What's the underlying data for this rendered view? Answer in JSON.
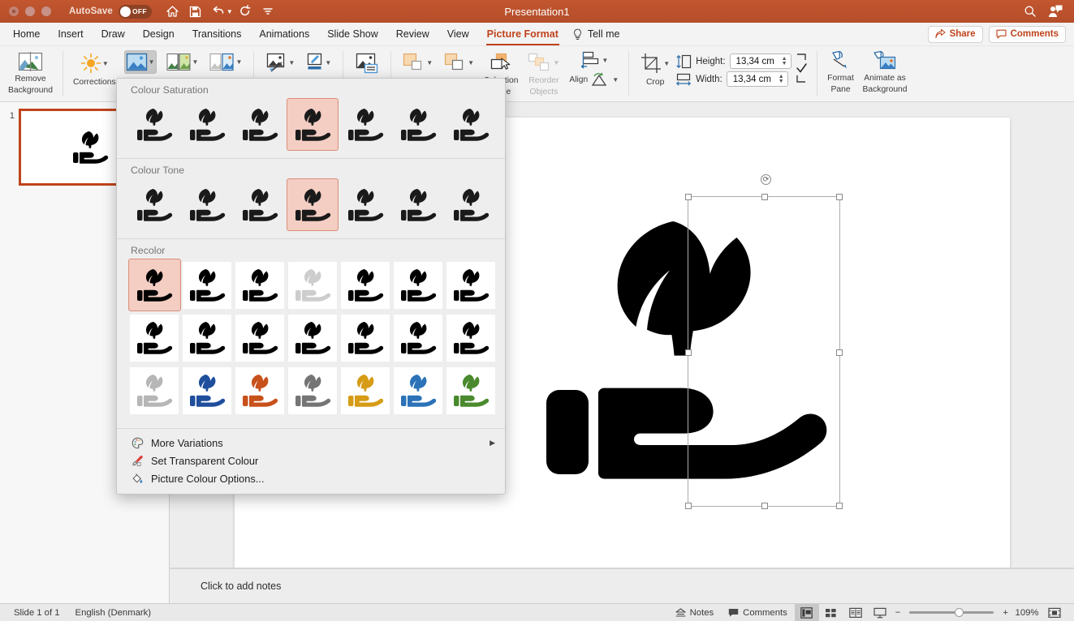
{
  "window": {
    "title": "Presentation1",
    "autosave_label": "AutoSave",
    "autosave_state": "OFF",
    "quick_access": [
      "home-icon",
      "save-icon",
      "undo-icon",
      "redo-icon",
      "customize-icon"
    ],
    "search_icon": "search-icon",
    "account_icon": "account-icon"
  },
  "tabs": [
    {
      "label": "Home",
      "active": false
    },
    {
      "label": "Insert",
      "active": false
    },
    {
      "label": "Draw",
      "active": false
    },
    {
      "label": "Design",
      "active": false
    },
    {
      "label": "Transitions",
      "active": false
    },
    {
      "label": "Animations",
      "active": false
    },
    {
      "label": "Slide Show",
      "active": false
    },
    {
      "label": "Review",
      "active": false
    },
    {
      "label": "View",
      "active": false
    },
    {
      "label": "Picture Format",
      "active": true
    }
  ],
  "tellme": {
    "label": "Tell me",
    "icon": "lightbulb-icon"
  },
  "tabbar_right": [
    {
      "label": "Share",
      "icon": "share-icon"
    },
    {
      "label": "Comments",
      "icon": "comment-icon"
    }
  ],
  "ribbon": {
    "remove_background": "Remove\nBackground",
    "remove_background_line1": "Remove",
    "remove_background_line2": "Background",
    "corrections": "Corrections",
    "colour_button": "colour-picture-icon",
    "artistic_effects": "artistic-effects-icon",
    "transparency": "transparency-icon",
    "picture_styles": "picture-styles-icon",
    "picture_border": "picture-border-icon",
    "picture_effects": "picture-effects-icon",
    "alt_text": "alt-text-icon",
    "bring_forward": "bring-forward-icon",
    "send_backward": "send-backward-icon",
    "selection_pane_line1": "Selection",
    "selection_pane_line2": "Pane",
    "reorder_objects_line1": "Reorder",
    "reorder_objects_line2": "Objects",
    "align": "Align",
    "rotate": "rotate-icon",
    "crop": "Crop",
    "height_label": "Height:",
    "height_value": "13,34 cm",
    "width_label": "Width:",
    "width_value": "13,34 cm",
    "format_pane_line1": "Format",
    "format_pane_line2": "Pane",
    "animate_bg_line1": "Animate as",
    "animate_bg_line2": "Background"
  },
  "colour_menu": {
    "sections": [
      {
        "title": "Colour Saturation",
        "items": [
          {
            "name": "saturation-0",
            "selected": false,
            "fill": "#1a1a1a",
            "white_tile": false
          },
          {
            "name": "saturation-33",
            "selected": false,
            "fill": "#1a1a1a",
            "white_tile": false
          },
          {
            "name": "saturation-66",
            "selected": false,
            "fill": "#1a1a1a",
            "white_tile": false
          },
          {
            "name": "saturation-100",
            "selected": true,
            "fill": "#1a1a1a",
            "white_tile": false
          },
          {
            "name": "saturation-200",
            "selected": false,
            "fill": "#1a1a1a",
            "white_tile": false
          },
          {
            "name": "saturation-300",
            "selected": false,
            "fill": "#1a1a1a",
            "white_tile": false
          },
          {
            "name": "saturation-400",
            "selected": false,
            "fill": "#1a1a1a",
            "white_tile": false
          }
        ]
      },
      {
        "title": "Colour Tone",
        "items": [
          {
            "name": "tone-4700k",
            "selected": false,
            "fill": "#1a1a1a",
            "white_tile": false
          },
          {
            "name": "tone-5300k",
            "selected": false,
            "fill": "#1a1a1a",
            "white_tile": false
          },
          {
            "name": "tone-5900k",
            "selected": false,
            "fill": "#1a1a1a",
            "white_tile": false
          },
          {
            "name": "tone-6500k",
            "selected": true,
            "fill": "#1a1a1a",
            "white_tile": false
          },
          {
            "name": "tone-7200k",
            "selected": false,
            "fill": "#1a1a1a",
            "white_tile": false
          },
          {
            "name": "tone-8800k",
            "selected": false,
            "fill": "#1a1a1a",
            "white_tile": false
          },
          {
            "name": "tone-11200k",
            "selected": false,
            "fill": "#1a1a1a",
            "white_tile": false
          }
        ]
      },
      {
        "title": "Recolor",
        "items": [
          {
            "name": "recolor-no-recolor",
            "selected": true,
            "fill": "#000000",
            "white_tile": false
          },
          {
            "name": "recolor-grayscale",
            "selected": false,
            "fill": "#000000",
            "white_tile": true
          },
          {
            "name": "recolor-sepia",
            "selected": false,
            "fill": "#000000",
            "white_tile": true
          },
          {
            "name": "recolor-washout",
            "selected": false,
            "fill": "#cdcdcd",
            "white_tile": true
          },
          {
            "name": "recolor-black-white",
            "selected": false,
            "fill": "#000000",
            "white_tile": true
          },
          {
            "name": "recolor-dark-variant-1",
            "selected": false,
            "fill": "#000000",
            "white_tile": true
          },
          {
            "name": "recolor-dark-variant-2",
            "selected": false,
            "fill": "#000000",
            "white_tile": true
          },
          {
            "name": "recolor-dark-variant-3",
            "selected": false,
            "fill": "#000000",
            "white_tile": true
          },
          {
            "name": "recolor-dark-variant-4",
            "selected": false,
            "fill": "#000000",
            "white_tile": true
          },
          {
            "name": "recolor-dark-variant-5",
            "selected": false,
            "fill": "#000000",
            "white_tile": true
          },
          {
            "name": "recolor-dark-variant-6",
            "selected": false,
            "fill": "#000000",
            "white_tile": true
          },
          {
            "name": "recolor-dark-variant-7",
            "selected": false,
            "fill": "#000000",
            "white_tile": true
          },
          {
            "name": "recolor-dark-variant-8",
            "selected": false,
            "fill": "#000000",
            "white_tile": true
          },
          {
            "name": "recolor-dark-variant-9",
            "selected": false,
            "fill": "#000000",
            "white_tile": true
          },
          {
            "name": "recolor-light-grey",
            "selected": false,
            "fill": "#b6b6b6",
            "white_tile": true
          },
          {
            "name": "recolor-dark-blue",
            "selected": false,
            "fill": "#1f4e9c",
            "white_tile": true
          },
          {
            "name": "recolor-orange",
            "selected": false,
            "fill": "#c8511b",
            "white_tile": true
          },
          {
            "name": "recolor-grey",
            "selected": false,
            "fill": "#757575",
            "white_tile": true
          },
          {
            "name": "recolor-gold",
            "selected": false,
            "fill": "#d69c16",
            "white_tile": true
          },
          {
            "name": "recolor-blue",
            "selected": false,
            "fill": "#2b72b8",
            "white_tile": true
          },
          {
            "name": "recolor-green",
            "selected": false,
            "fill": "#4a8a2d",
            "white_tile": true
          }
        ]
      }
    ],
    "footer": [
      {
        "label": "More Variations",
        "icon": "palette-icon",
        "submenu": "▶",
        "has_submenu": true
      },
      {
        "label": "Set Transparent Colour",
        "icon": "eyedropper-icon",
        "submenu": "",
        "has_submenu": false
      },
      {
        "label": "Picture Colour Options...",
        "icon": "paint-bucket-icon",
        "submenu": "",
        "has_submenu": false
      }
    ],
    "highlight_color": "#f4cdc3",
    "highlight_border": "#d98f79"
  },
  "thumbnails": [
    {
      "number": "1",
      "selected": true
    }
  ],
  "notes": {
    "placeholder": "Click to add notes"
  },
  "statusbar": {
    "slide_count": "Slide 1 of 1",
    "language": "English (Denmark)",
    "notes_label": "Notes",
    "comments_label": "Comments",
    "views": [
      "normal-view-icon",
      "slide-sorter-icon",
      "reading-view-icon",
      "slideshow-icon"
    ],
    "zoom_out": "−",
    "zoom_in": "+",
    "zoom_level": "109%",
    "fit_icon": "fit-slide-icon"
  }
}
